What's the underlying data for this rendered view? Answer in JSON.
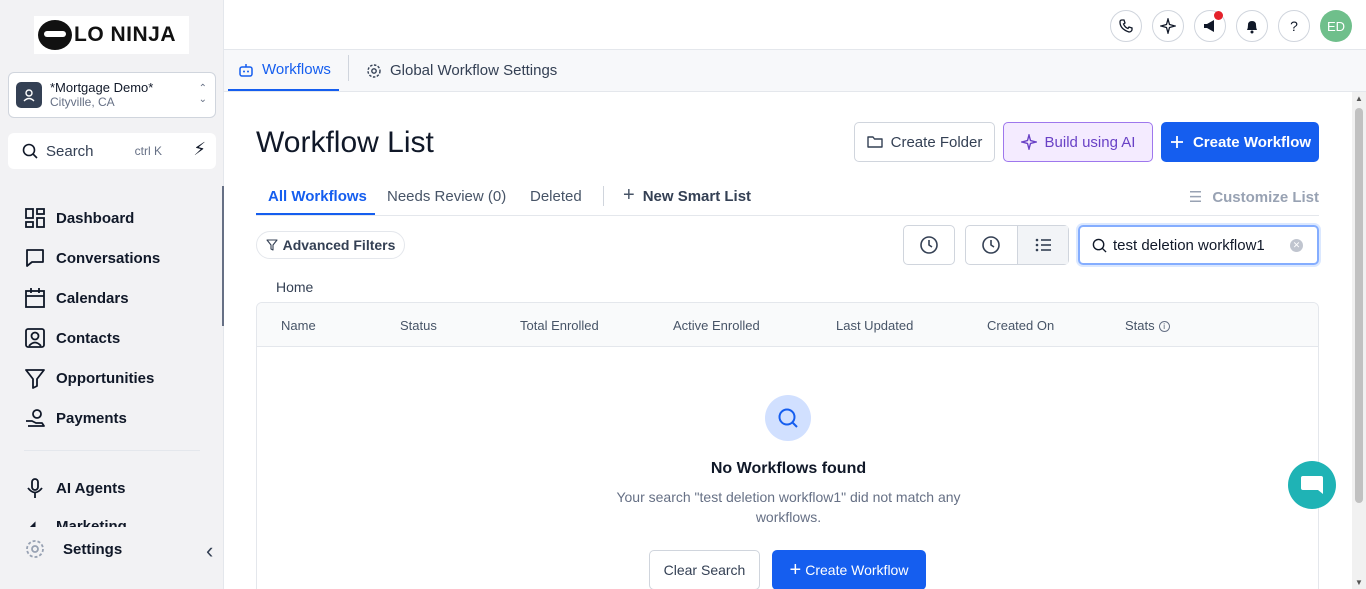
{
  "brand": {
    "logo_text": "LO NINJA"
  },
  "account": {
    "name": "*Mortgage Demo*",
    "location": "Cityville, CA"
  },
  "sidebar": {
    "search_label": "Search",
    "search_shortcut": "ctrl K",
    "items": [
      {
        "label": "Dashboard",
        "icon": "dashboard-icon"
      },
      {
        "label": "Conversations",
        "icon": "chat-icon"
      },
      {
        "label": "Calendars",
        "icon": "calendar-icon"
      },
      {
        "label": "Contacts",
        "icon": "contacts-icon"
      },
      {
        "label": "Opportunities",
        "icon": "filter-icon"
      },
      {
        "label": "Payments",
        "icon": "payments-icon"
      }
    ],
    "items2": [
      {
        "label": "AI Agents",
        "icon": "microphone-icon"
      },
      {
        "label": "Marketing",
        "icon": "megaphone-icon"
      }
    ],
    "settings_label": "Settings"
  },
  "header": {
    "icons": [
      "phone-icon",
      "sparkle-icon",
      "megaphone-icon",
      "bell-icon",
      "help-icon"
    ],
    "avatar_initials": "ED",
    "help_glyph": "?"
  },
  "subtabs": {
    "workflows": "Workflows",
    "global_settings": "Global Workflow Settings"
  },
  "main": {
    "title": "Workflow List",
    "create_folder": "Create Folder",
    "build_ai": "Build using AI",
    "create_workflow": "Create Workflow",
    "tabs": {
      "all": "All Workflows",
      "needs_review": "Needs Review (0)",
      "deleted": "Deleted",
      "new_smart_list": "New Smart List",
      "customize_list": "Customize List"
    },
    "advanced_filters": "Advanced Filters",
    "search_value": "test deletion workflow1",
    "breadcrumb": "Home",
    "columns": [
      "Name",
      "Status",
      "Total Enrolled",
      "Active Enrolled",
      "Last Updated",
      "Created On",
      "Stats"
    ],
    "empty_title": "No Workflows found",
    "empty_message": "Your search \"test deletion workflow1\" did not match any workflows.",
    "clear_search": "Clear Search",
    "empty_create": "Create Workflow"
  },
  "colors": {
    "accent": "#155eef",
    "ai_purple": "#6941c6",
    "chat_teal": "#1fb3b5",
    "avatar_green": "#6fbf8b",
    "notification_red": "#e4222b"
  }
}
